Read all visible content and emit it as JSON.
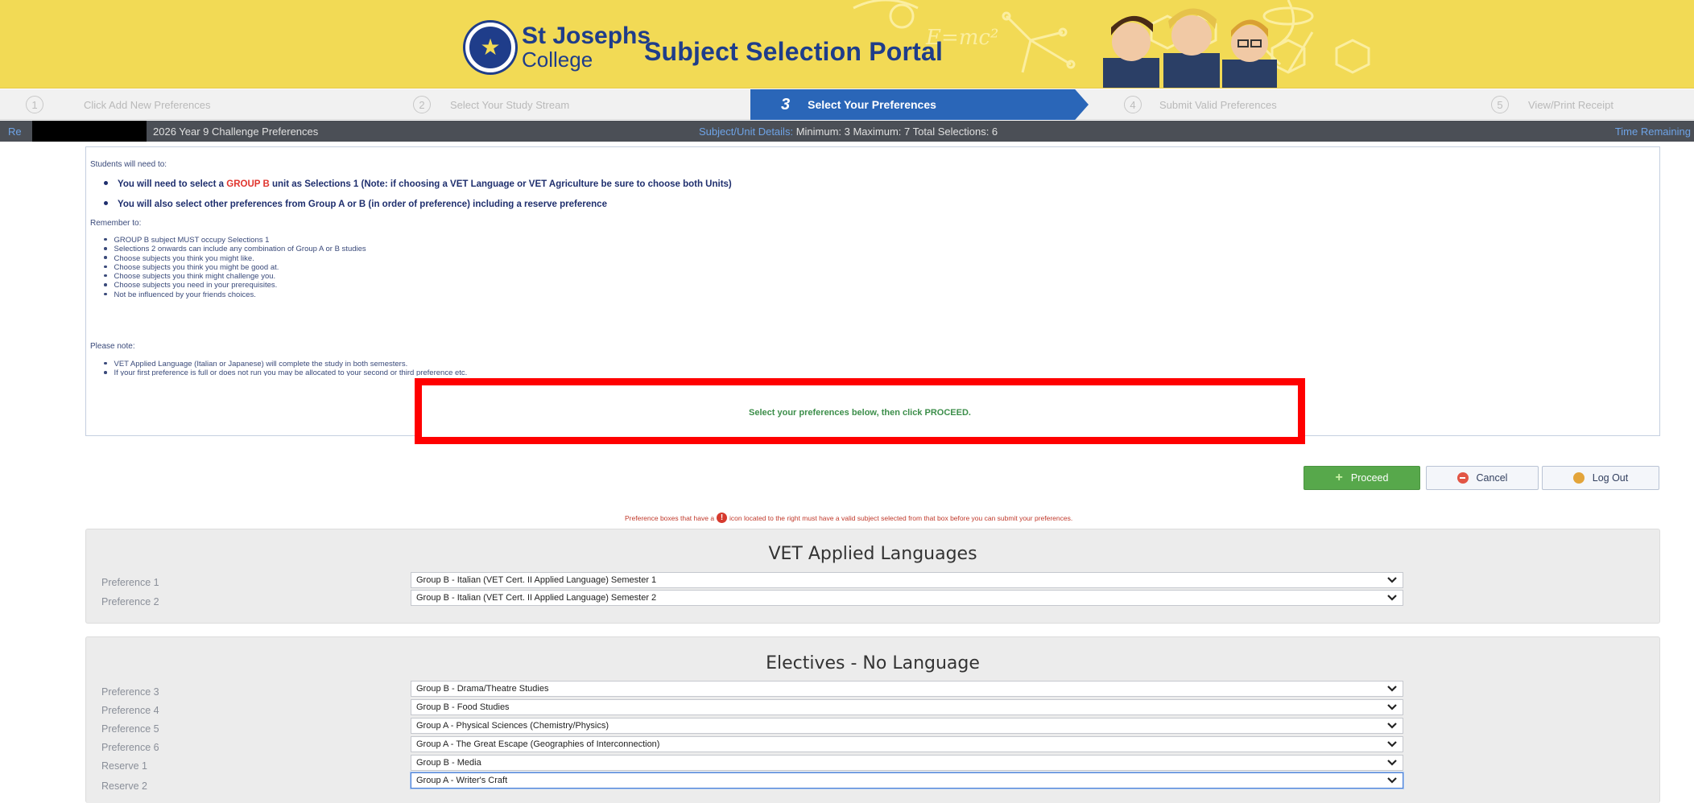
{
  "header": {
    "college_line1": "St Josephs",
    "college_line2": "College",
    "portal_title": "Subject Selection Portal",
    "accent": "#f2da55",
    "brand": "#1f3d8a"
  },
  "steps": [
    {
      "num": "1",
      "label": "Click Add New Preferences"
    },
    {
      "num": "2",
      "label": "Select Your Study Stream"
    },
    {
      "num": "3",
      "label": "Select Your Preferences"
    },
    {
      "num": "4",
      "label": "Submit Valid Preferences"
    },
    {
      "num": "5",
      "label": "View/Print Receipt"
    }
  ],
  "infobar": {
    "left_fragment": "Re",
    "title": "2026 Year 9 Challenge Preferences",
    "details_label": "Subject/Unit Details:",
    "details_value": "Minimum: 3 Maximum: 7 Total Selections: 6",
    "time_label": "Time Remaining"
  },
  "instructions": {
    "intro": "Students will need to:",
    "big1_pre": "You will need to select a",
    "big1_red": "GROUP B",
    "big1_post": "unit as Selections 1 (Note: if choosing a VET Language or VET Agriculture be sure to choose both Units)",
    "big2": "You will also select other preferences from Group A or B (in order of preference) including a reserve preference",
    "remember": "Remember to:",
    "remember_items": [
      "GROUP B subject MUST occupy Selections 1",
      "Selections 2 onwards can include any combination of Group A or B studies",
      "Choose subjects you think you might like.",
      "Choose subjects you think you might be good at.",
      "Choose subjects you think might challenge you.",
      "Choose subjects you need in your prerequisites.",
      "Not be influenced by your friends choices."
    ],
    "note": "Please note:",
    "note_items": [
      "VET Applied Language (Italian or Japanese) will complete the study in both semesters.",
      "If your first preference is full or does not run you may be allocated to your second or third preference etc."
    ],
    "highlight_text": "Select your preferences below, then click PROCEED."
  },
  "buttons": {
    "proceed": "Proceed",
    "cancel": "Cancel",
    "logout": "Log Out"
  },
  "warning": {
    "pre": "Preference boxes that have a",
    "post": "icon located to the right must have a valid subject selected from that box before you can submit your preferences.",
    "icon_glyph": "!"
  },
  "panels": [
    {
      "title": "VET Applied Languages",
      "rows": [
        {
          "label": "Preference 1",
          "value": "Group B - Italian (VET Cert. II Applied Language) Semester 1"
        },
        {
          "label": "Preference 2",
          "value": "Group B - Italian (VET Cert. II Applied Language) Semester 2"
        }
      ]
    },
    {
      "title": "Electives - No Language",
      "rows": [
        {
          "label": "Preference 3",
          "value": "Group B - Drama/Theatre Studies"
        },
        {
          "label": "Preference 4",
          "value": "Group B - Food Studies"
        },
        {
          "label": "Preference 5",
          "value": "Group A - Physical Sciences (Chemistry/Physics)"
        },
        {
          "label": "Preference 6",
          "value": "Group A - The Great Escape (Geographies of Interconnection)"
        },
        {
          "label": "Reserve 1",
          "value": "Group B - Media"
        },
        {
          "label": "Reserve 2",
          "value": "Group A - Writer's Craft"
        }
      ]
    }
  ]
}
